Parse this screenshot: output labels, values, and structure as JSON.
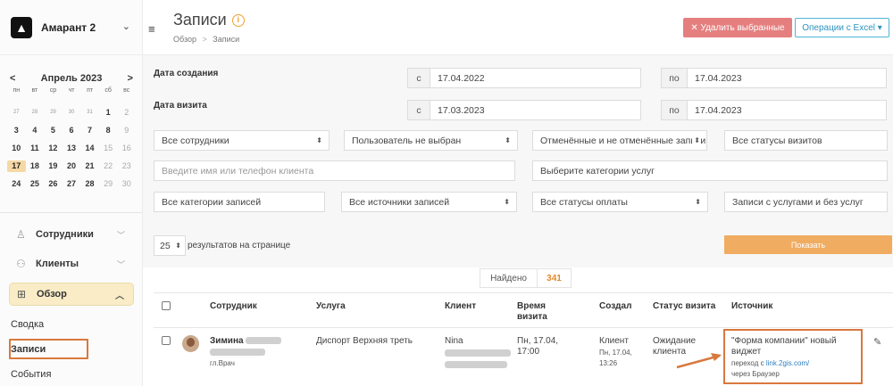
{
  "sidebar": {
    "org_name": "Амарант 2",
    "calendar": {
      "month_label": "Апрель 2023",
      "prev": "<",
      "next": ">",
      "weekdays": [
        "пн",
        "вт",
        "ср",
        "чт",
        "пт",
        "сб",
        "вс"
      ],
      "weeks": [
        [
          "27",
          "28",
          "29",
          "30",
          "31",
          "1",
          "2"
        ],
        [
          "3",
          "4",
          "5",
          "6",
          "7",
          "8",
          "9"
        ],
        [
          "10",
          "11",
          "12",
          "13",
          "14",
          "15",
          "16"
        ],
        [
          "17",
          "18",
          "19",
          "20",
          "21",
          "22",
          "23"
        ],
        [
          "24",
          "25",
          "26",
          "27",
          "28",
          "29",
          "30"
        ]
      ],
      "today": "17"
    },
    "nav": {
      "employees": "Сотрудники",
      "clients": "Клиенты",
      "overview": "Обзор"
    },
    "sub": {
      "summary": "Сводка",
      "records": "Записи",
      "events": "События"
    }
  },
  "header": {
    "title": "Записи",
    "breadcrumb_home": "Обзор",
    "breadcrumb_sep": ">",
    "breadcrumb_current": "Записи",
    "delete_btn": "✕ Удалить выбранные",
    "excel_btn": "Операции с Excel ▾"
  },
  "filters": {
    "created_label": "Дата создания",
    "visit_label": "Дата визита",
    "from": "с",
    "to": "по",
    "created_from": "17.04.2022",
    "created_to": "17.04.2023",
    "visit_from": "17.03.2023",
    "visit_to": "17.04.2023",
    "employees": "Все сотрудники",
    "user": "Пользователь не выбран",
    "cancelled": "Отменённые и не отменённые записи",
    "visit_statuses": "Все статусы визитов",
    "client_placeholder": "Введите имя или телефон клиента",
    "service_categories": "Выберите категории услуг",
    "record_categories": "Все категории записей",
    "sources": "Все источники записей",
    "payment_statuses": "Все статусы оплаты",
    "services_filter": "Записи с услугами и без услуг",
    "per_page_value": "25",
    "per_page_label": "результатов на странице",
    "show_btn": "Показать"
  },
  "results": {
    "found_label": "Найдено",
    "found_count": "341"
  },
  "table": {
    "headers": {
      "employee": "Сотрудник",
      "service": "Услуга",
      "client": "Клиент",
      "visit_time_1": "Время",
      "visit_time_2": "визита",
      "created": "Создал",
      "status": "Статус визита",
      "source": "Источник"
    },
    "row": {
      "employee_name": "Зимина",
      "employee_role": "гл.Врач",
      "service": "Диспорт Верхняя треть",
      "client": "Nina",
      "visit_date": "Пн, 17.04,",
      "visit_time": "17:00",
      "created_by": "Клиент",
      "created_date": "Пн, 17.04,",
      "created_time": "13:26",
      "status_1": "Ожидание",
      "status_2": "клиента",
      "source_1": "\"Форма компании\" новый",
      "source_2": "виджет",
      "source_link_prefix": "переход с",
      "source_link": "link.2gis.com/",
      "source_via": "через Браузер"
    }
  },
  "colors": {
    "accent": "#f0ac61",
    "danger": "#e57f7f",
    "highlight": "#d9783d",
    "link": "#2e7fc0"
  }
}
